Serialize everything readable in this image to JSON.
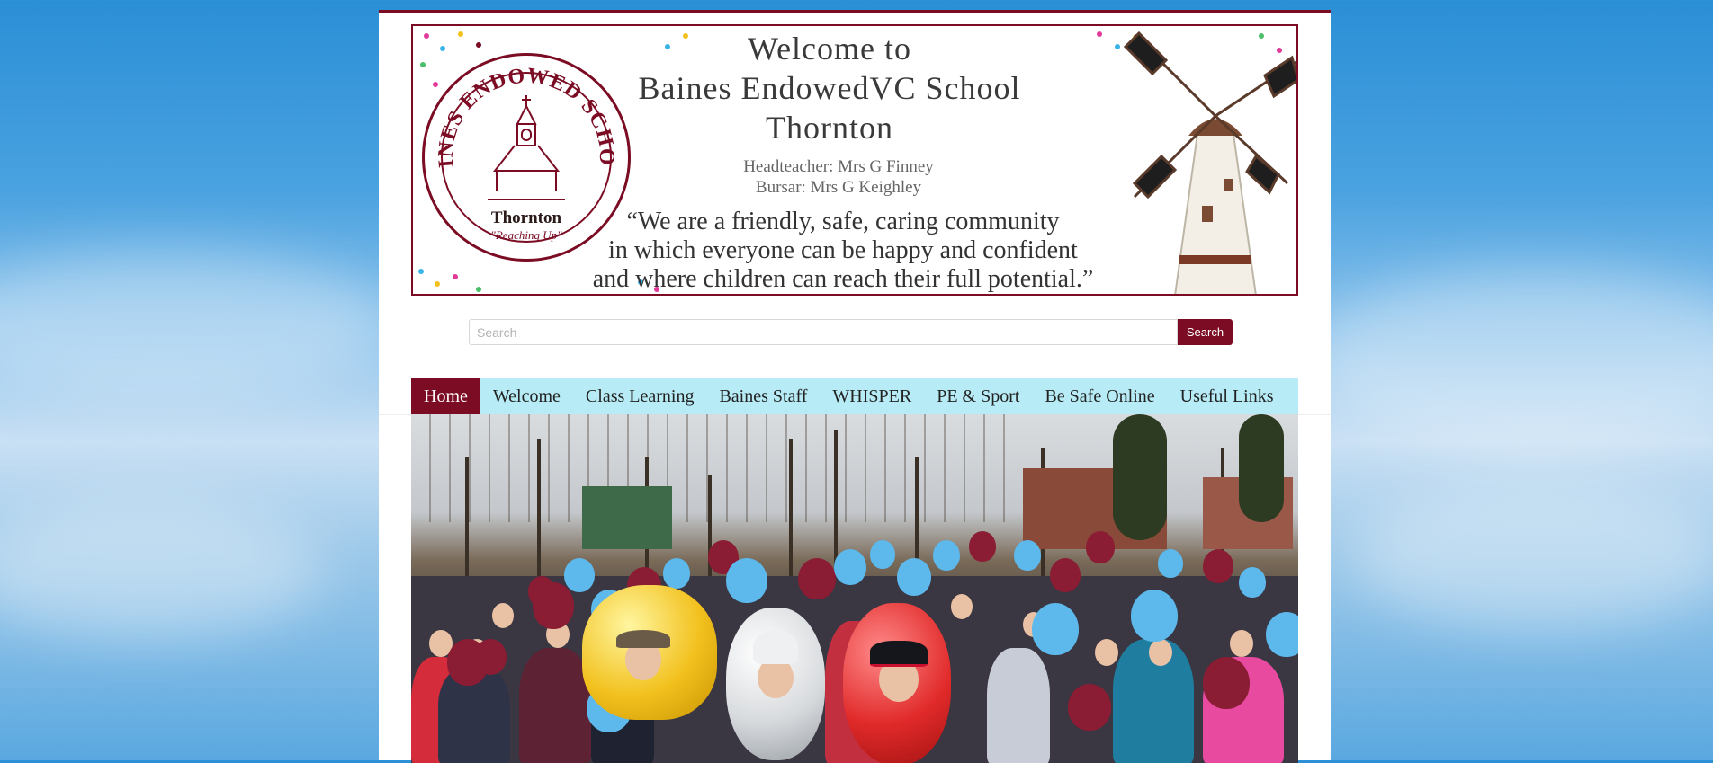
{
  "banner": {
    "welcome_line1": "Welcome to",
    "welcome_line2": "Baines EndowedVC School",
    "welcome_line3": "Thornton",
    "headteacher": "Headteacher: Mrs G Finney",
    "bursar": "Bursar: Mrs G Keighley",
    "quote_line1": "“We are a friendly, safe, caring community",
    "quote_line2": "in which everyone can be happy and confident",
    "quote_line3": "and where children can reach their full potential.”",
    "seal_ring": "BAINES ENDOWED SCHOOL",
    "seal_town": "Thornton",
    "seal_motto": "\"Reaching Up\""
  },
  "search": {
    "placeholder": "Search",
    "button_label": "Search"
  },
  "nav": {
    "items": [
      {
        "label": "Home",
        "active": true
      },
      {
        "label": "Welcome",
        "active": false
      },
      {
        "label": "Class Learning",
        "active": false
      },
      {
        "label": "Baines Staff",
        "active": false
      },
      {
        "label": "WHISPER",
        "active": false
      },
      {
        "label": "PE & Sport",
        "active": false
      },
      {
        "label": "Be Safe Online",
        "active": false
      },
      {
        "label": "Useful Links",
        "active": false
      }
    ]
  },
  "colors": {
    "brand": "#7b0c24",
    "nav_bg": "#b7ecf6",
    "balloon_blue": "#5db8ec",
    "balloon_maroon": "#8a1c33"
  },
  "hero": {
    "number_balloons": "30"
  }
}
